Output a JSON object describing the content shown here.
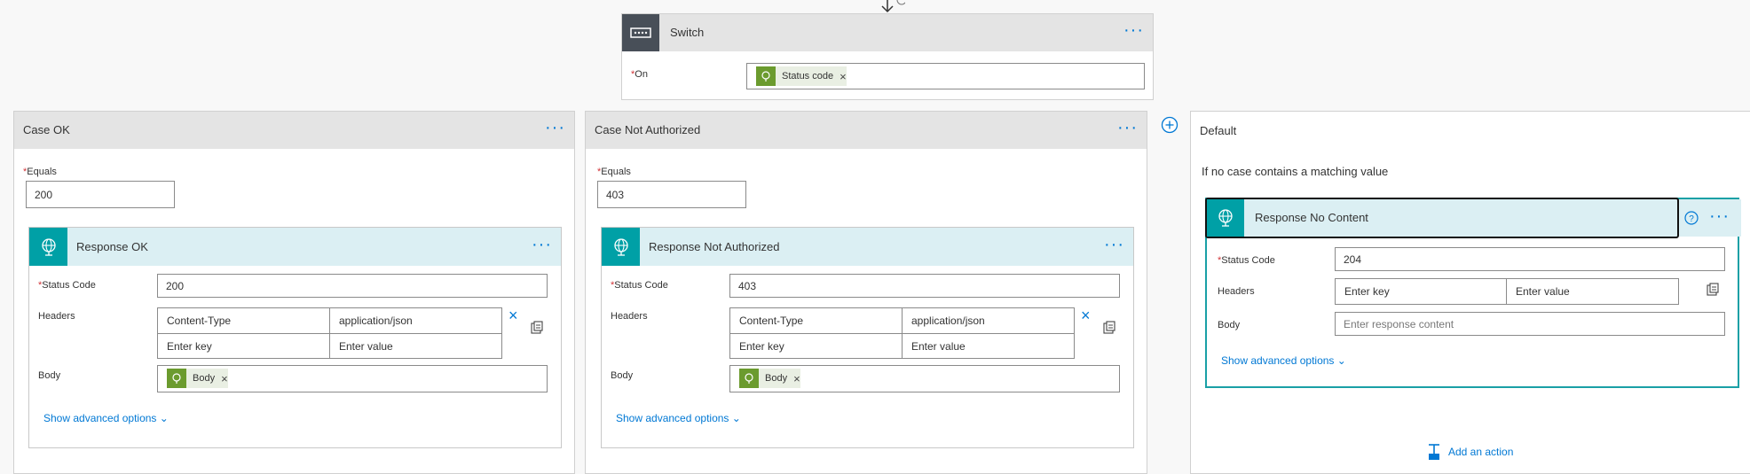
{
  "switch": {
    "title": "Switch",
    "on_label": "On",
    "token": "Status code"
  },
  "cases": [
    {
      "title": "Case OK",
      "equals_label": "Equals",
      "equals_value": "200",
      "response": {
        "title": "Response OK",
        "status_label": "Status Code",
        "status_value": "200",
        "headers_label": "Headers",
        "header_key": "Content-Type",
        "header_value": "application/json",
        "key_placeholder": "Enter key",
        "value_placeholder": "Enter value",
        "body_label": "Body",
        "body_token": "Body",
        "advanced": "Show advanced options"
      }
    },
    {
      "title": "Case Not Authorized",
      "equals_label": "Equals",
      "equals_value": "403",
      "response": {
        "title": "Response Not Authorized",
        "status_label": "Status Code",
        "status_value": "403",
        "headers_label": "Headers",
        "header_key": "Content-Type",
        "header_value": "application/json",
        "key_placeholder": "Enter key",
        "value_placeholder": "Enter value",
        "body_label": "Body",
        "body_token": "Body",
        "advanced": "Show advanced options"
      }
    }
  ],
  "default": {
    "title": "Default",
    "note": "If no case contains a matching value",
    "response": {
      "title": "Response No Content",
      "status_label": "Status Code",
      "status_value": "204",
      "headers_label": "Headers",
      "key_placeholder": "Enter key",
      "value_placeholder": "Enter value",
      "body_label": "Body",
      "body_placeholder": "Enter response content",
      "advanced": "Show advanced options"
    },
    "add_action": "Add an action"
  },
  "colors": {
    "accent": "#0078d4",
    "teal": "#00a0a6",
    "green": "#6b9b2e",
    "required": "#d13438"
  }
}
